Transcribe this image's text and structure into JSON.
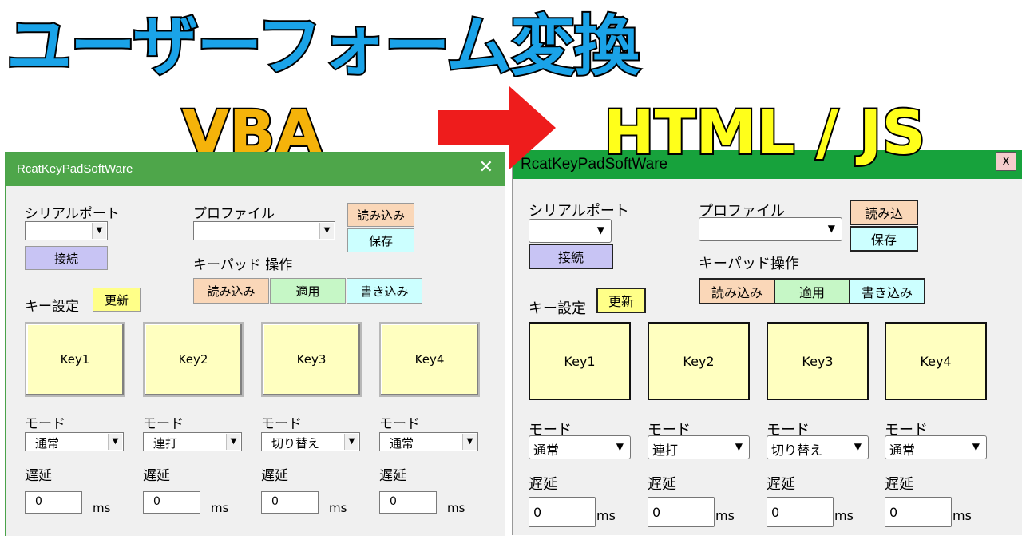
{
  "banner": {
    "title": "ユーザーフォーム変換",
    "from_label": "VBA",
    "to_label": "HTML / JS"
  },
  "vba_form": {
    "title": "RcatKeyPadSoftWare",
    "close": "✕",
    "serial_label": "シリアルポート",
    "serial_value": "",
    "connect_button": "接続",
    "profile_label": "プロファイル",
    "profile_value": "",
    "profile_load_button": "読み込み",
    "profile_save_button": "保存",
    "keypad_label": "キーパッド 操作",
    "keypad_buttons": [
      "読み込み",
      "適用",
      "書き込み"
    ],
    "key_settings_label": "キー設定",
    "refresh_button": "更新",
    "keys": [
      {
        "name": "Key1",
        "mode_label": "モード",
        "mode": "通常",
        "delay_label": "遅延",
        "delay": "0",
        "unit": "ms"
      },
      {
        "name": "Key2",
        "mode_label": "モード",
        "mode": "連打",
        "delay_label": "遅延",
        "delay": "0",
        "unit": "ms"
      },
      {
        "name": "Key3",
        "mode_label": "モード",
        "mode": "切り替え",
        "delay_label": "遅延",
        "delay": "0",
        "unit": "ms"
      },
      {
        "name": "Key4",
        "mode_label": "モード",
        "mode": "通常",
        "delay_label": "遅延",
        "delay": "0",
        "unit": "ms"
      }
    ]
  },
  "html_form": {
    "title": "RcatKeyPadSoftWare",
    "close": "X",
    "serial_label": "シリアルポート",
    "serial_value": "",
    "connect_button": "接続",
    "profile_label": "プロファイル",
    "profile_value": "",
    "profile_load_button": "読み込",
    "profile_save_button": "保存",
    "keypad_label": "キーパッド操作",
    "keypad_buttons": [
      "読み込み",
      "適用",
      "書き込み"
    ],
    "key_settings_label": "キー設定",
    "refresh_button": "更新",
    "keys": [
      {
        "name": "Key1",
        "mode_label": "モード",
        "mode": "通常",
        "delay_label": "遅延",
        "delay": "0",
        "unit": "ms"
      },
      {
        "name": "Key2",
        "mode_label": "モード",
        "mode": "連打",
        "delay_label": "遅延",
        "delay": "0",
        "unit": "ms"
      },
      {
        "name": "Key3",
        "mode_label": "モード",
        "mode": "切り替え",
        "delay_label": "遅延",
        "delay": "0",
        "unit": "ms"
      },
      {
        "name": "Key4",
        "mode_label": "モード",
        "mode": "通常",
        "delay_label": "遅延",
        "delay": "0",
        "unit": "ms"
      }
    ]
  },
  "colors": {
    "title_blue": "#1aa3e8",
    "vba_orange": "#f5b30a",
    "html_yellow": "#ffff1a",
    "arrow_red": "#ee1c1c",
    "vba_titlebar": "#4ea64a",
    "html_titlebar": "#17a23c",
    "key_fill": "#ffffc0",
    "btn_purple": "#c8c4f4",
    "btn_orange": "#fad7b8",
    "btn_cyan": "#ccffff",
    "btn_green": "#c6f7c6",
    "btn_yellow": "#ffff88"
  }
}
